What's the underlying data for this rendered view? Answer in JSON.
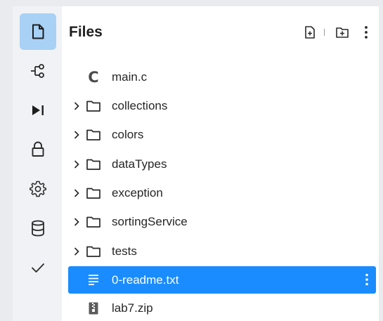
{
  "activity_bar": {
    "items": [
      {
        "icon": "file-icon",
        "active": true
      },
      {
        "icon": "git-branch-icon"
      },
      {
        "icon": "run-icon"
      },
      {
        "icon": "lock-icon"
      },
      {
        "icon": "gear-icon"
      },
      {
        "icon": "database-icon"
      },
      {
        "icon": "checkmark-icon"
      }
    ],
    "accent_color": "#a8d1f5"
  },
  "panel": {
    "title": "Files",
    "header_actions": [
      "new-file-icon",
      "new-folder-icon",
      "more-vertical-icon"
    ]
  },
  "file_tree": {
    "items": [
      {
        "label": "main.c",
        "type": "c-file",
        "icon": "c-language-icon"
      },
      {
        "label": "collections",
        "type": "folder",
        "icon": "folder-icon"
      },
      {
        "label": "colors",
        "type": "folder",
        "icon": "folder-icon"
      },
      {
        "label": "dataTypes",
        "type": "folder",
        "icon": "folder-icon"
      },
      {
        "label": "exception",
        "type": "folder",
        "icon": "folder-icon"
      },
      {
        "label": "sortingService",
        "type": "folder",
        "icon": "folder-icon"
      },
      {
        "label": "tests",
        "type": "folder",
        "icon": "folder-icon"
      },
      {
        "label": "0-readme.txt",
        "type": "text-file",
        "icon": "text-lines-icon",
        "selected": true
      },
      {
        "label": "lab7.zip",
        "type": "archive",
        "icon": "zip-file-icon"
      }
    ],
    "selection_color": "#1a8cff"
  }
}
